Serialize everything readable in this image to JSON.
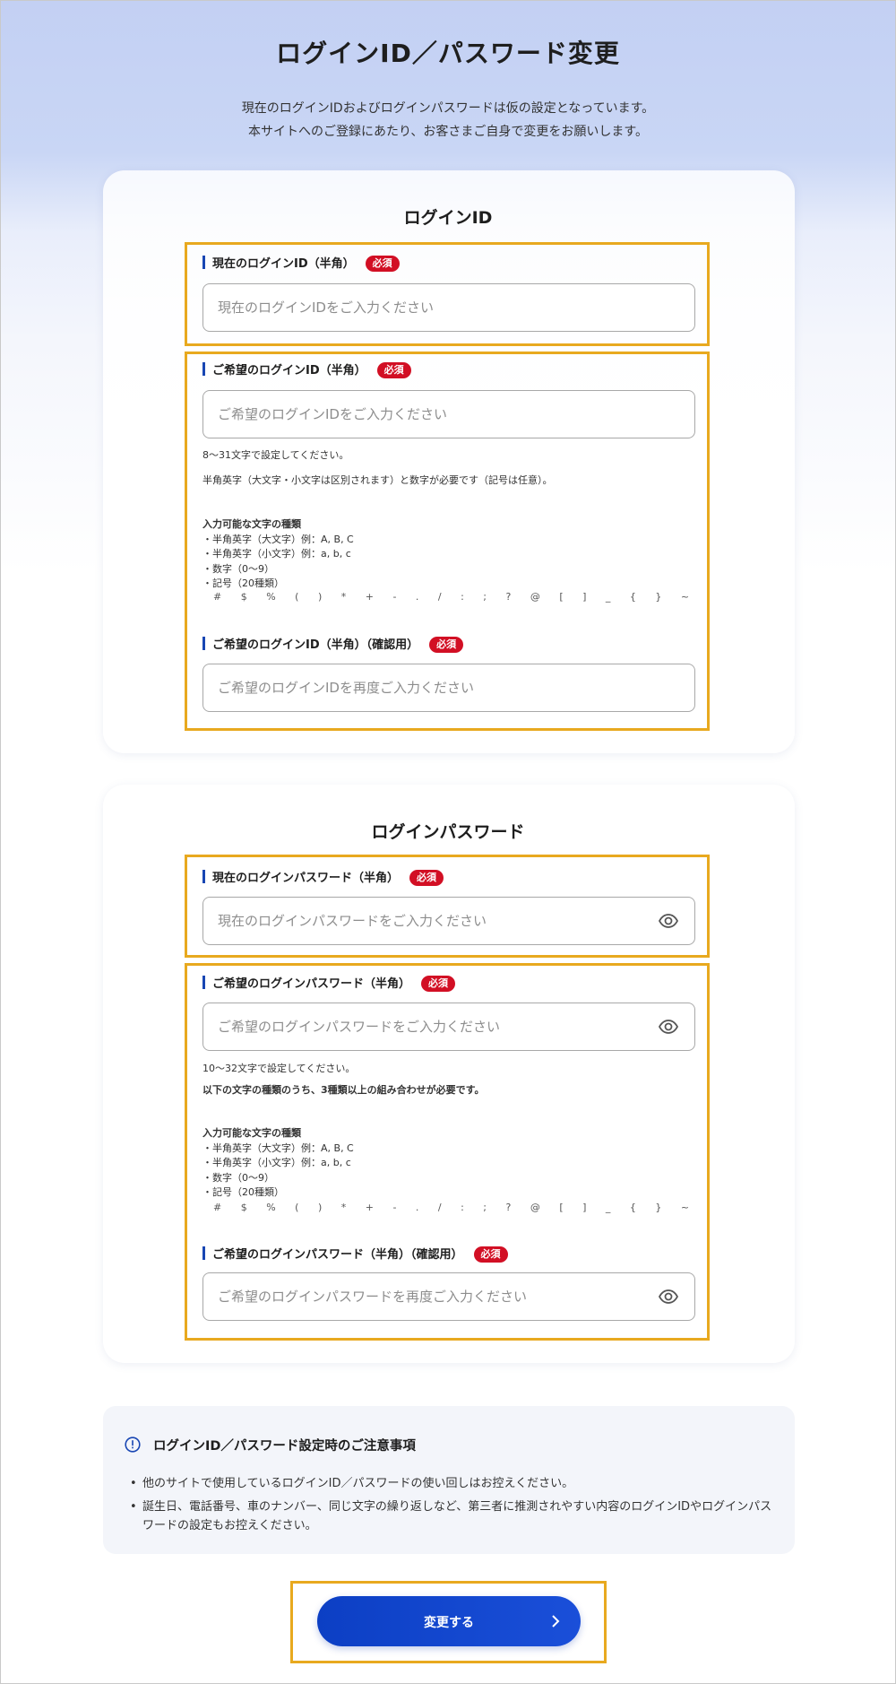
{
  "page": {
    "title": "ログインID／パスワード変更",
    "intro_line1": "現在のログインIDおよびログインパスワードは仮の設定となっています。",
    "intro_line2": "本サイトへのご登録にあたり、お客さまご自身で変更をお願いします。"
  },
  "login_id": {
    "title": "ログインID",
    "current": {
      "label": "現在のログインID（半角）",
      "required": "必須",
      "placeholder": "現在のログインIDをご入力ください",
      "value": ""
    },
    "new": {
      "label": "ご希望のログインID（半角）",
      "required": "必須",
      "placeholder": "ご希望のログインIDをご入力ください",
      "value": ""
    },
    "rule_length": "8〜31文字で設定してください。",
    "rule_combo": "半角英字（大文字・小文字は区別されます）と数字が必要です（記号は任意）。",
    "chars_heading": "入力可能な文字の種類",
    "chars": [
      "・半角英字（大文字）例：A, B, C",
      "・半角英字（小文字）例：a, b, c",
      "・数字（0〜9）",
      "・記号（20種類）"
    ],
    "symbols": "# $ % ( ) * + - . / : ; ? @ [ ] _ { } ~",
    "confirm": {
      "label": "ご希望のログインID（半角）（確認用）",
      "required": "必須",
      "placeholder": "ご希望のログインIDを再度ご入力ください",
      "value": ""
    }
  },
  "password": {
    "title": "ログインパスワード",
    "current": {
      "label": "現在のログインパスワード（半角）",
      "required": "必須",
      "placeholder": "現在のログインパスワードをご入力ください",
      "value": ""
    },
    "new": {
      "label": "ご希望のログインパスワード（半角）",
      "required": "必須",
      "placeholder": "ご希望のログインパスワードをご入力ください",
      "value": ""
    },
    "rule_length": "10〜32文字で設定してください。",
    "rule_combo": "以下の文字の種類のうち、3種類以上の組み合わせが必要です。",
    "chars_heading": "入力可能な文字の種類",
    "chars": [
      "・半角英字（大文字）例：A, B, C",
      "・半角英字（小文字）例：a, b, c",
      "・数字（0〜9）",
      "・記号（20種類）"
    ],
    "symbols": "# $ % ( ) * + - . / : ; ? @ [ ] _ { } ~",
    "confirm": {
      "label": "ご希望のログインパスワード（半角）（確認用）",
      "required": "必須",
      "placeholder": "ご希望のログインパスワードを再度ご入力ください",
      "value": ""
    },
    "eye_icon": "eye-icon"
  },
  "notice": {
    "icon": "info-circle-icon",
    "title": "ログインID／パスワード設定時のご注意事項",
    "items": [
      "他のサイトで使用しているログインID／パスワードの使い回しはお控えください。",
      "誕生日、電話番号、車のナンバー、同じ文字の繰り返しなど、第三者に推測されやすい内容のログインIDやログインパスワードの設定もお控えください。"
    ]
  },
  "submit": {
    "label": "変更する",
    "icon": "chevron-right-icon"
  },
  "colors": {
    "accent": "#1846b3",
    "button": "#0c3fc4",
    "required_badge": "#d20f24",
    "highlight": "#e8a91f"
  }
}
